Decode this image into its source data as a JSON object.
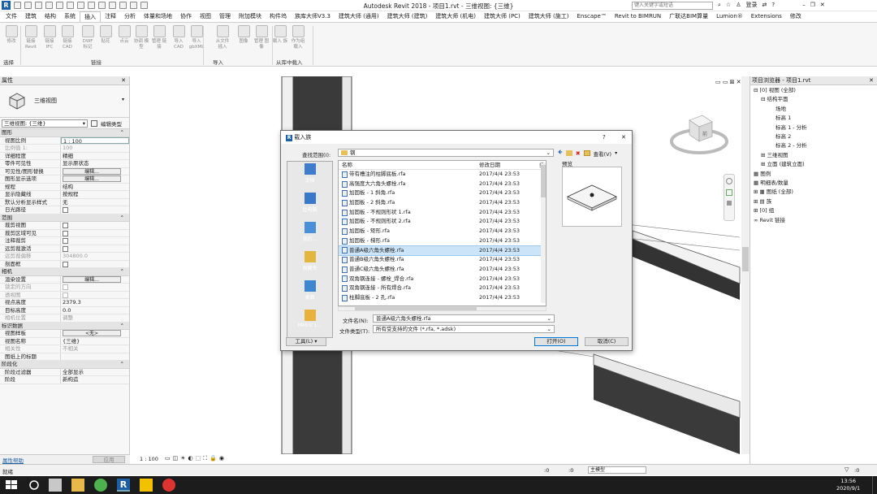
{
  "app": {
    "title": "Autodesk Revit 2018 -   项目1.rvt - 三维视图: {三维}",
    "search_placeholder": "键入关键字或短语",
    "login": "登录"
  },
  "menu": [
    "文件",
    "建筑",
    "结构",
    "系统",
    "插入",
    "注释",
    "分析",
    "体量和场地",
    "协作",
    "视图",
    "管理",
    "附加模块",
    "构件坞",
    "族库大师V3.3",
    "建筑大师 (通用)",
    "建筑大师 (建筑)",
    "建筑大师 (机电)",
    "建筑大师 (PC)",
    "建筑大师 (施工)",
    "Enscape™",
    "Revit to BIMRUN",
    "广联达BIM算量",
    "Lumion®",
    "Extensions",
    "修改"
  ],
  "active_menu_index": 4,
  "ribbon": {
    "buttons": [
      "修改",
      "链接 Revit",
      "链接 IFC",
      "链接 CAD",
      "DWF 标记",
      "贴花",
      "点云",
      "协调 模型",
      "管理 链接",
      "导入 CAD",
      "导入 gbXML",
      "从文件 插入",
      "图像",
      "管理 图像",
      "载入 族",
      "作为组 载入"
    ],
    "groups": [
      "选择",
      "链接",
      "导入",
      "从库中载入"
    ]
  },
  "properties": {
    "title": "属性",
    "type_name": "三维视图",
    "selector": "三维视图: {三维}",
    "edit_type": "编辑类型",
    "sections": [
      {
        "name": "图形",
        "rows": [
          [
            "视图比例",
            "1 : 100",
            ""
          ],
          [
            "比例值 1:",
            "100",
            "dim"
          ],
          [
            "详细程度",
            "精细",
            ""
          ],
          [
            "零件可见性",
            "显示原状态",
            ""
          ],
          [
            "可见性/图形替换",
            "编辑...",
            "btn"
          ],
          [
            "图形显示选项",
            "编辑...",
            "btn"
          ],
          [
            "规程",
            "结构",
            ""
          ],
          [
            "显示隐藏线",
            "按规程",
            ""
          ],
          [
            "默认分析显示样式",
            "无",
            ""
          ],
          [
            "日光路径",
            "",
            "cb"
          ]
        ]
      },
      {
        "name": "范围",
        "rows": [
          [
            "裁剪视图",
            "",
            "cb"
          ],
          [
            "裁剪区域可见",
            "",
            "cb"
          ],
          [
            "注释裁剪",
            "",
            "cb"
          ],
          [
            "远剪裁激活",
            "",
            "cb"
          ],
          [
            "远剪裁偏移",
            "304800.0",
            "dim"
          ],
          [
            "剖面框",
            "",
            "cb"
          ]
        ]
      },
      {
        "name": "相机",
        "rows": [
          [
            "渲染设置",
            "编辑...",
            "btn"
          ],
          [
            "锁定的方向",
            "",
            "dimcb"
          ],
          [
            "透视图",
            "",
            "dimcb"
          ],
          [
            "视点高度",
            "2379.3",
            ""
          ],
          [
            "目标高度",
            "0.0",
            ""
          ],
          [
            "相机位置",
            "调整",
            "dim"
          ]
        ]
      },
      {
        "name": "标识数据",
        "rows": [
          [
            "视图样板",
            "<无>",
            "btn"
          ],
          [
            "视图名称",
            "{三维}",
            ""
          ],
          [
            "相关性",
            "不相关",
            "dim"
          ],
          [
            "图纸上的标题",
            "",
            ""
          ]
        ]
      },
      {
        "name": "阶段化",
        "rows": [
          [
            "阶段过滤器",
            "全部显示",
            ""
          ],
          [
            "阶段",
            "新构造",
            ""
          ]
        ]
      }
    ],
    "help": "属性帮助",
    "apply": "应用"
  },
  "browser": {
    "title": "项目浏览器 - 项目1.rvt",
    "items": [
      {
        "text": "⊟ [0] 视图 (全部)",
        "indent": 0
      },
      {
        "text": "⊟ 结构平面",
        "indent": 1
      },
      {
        "text": "场地",
        "indent": 3
      },
      {
        "text": "标高 1",
        "indent": 3
      },
      {
        "text": "标高 1 - 分析",
        "indent": 3
      },
      {
        "text": "标高 2",
        "indent": 3
      },
      {
        "text": "标高 2 - 分析",
        "indent": 3
      },
      {
        "text": "⊞ 三维视图",
        "indent": 1
      },
      {
        "text": "⊞ 立面 (建筑立面)",
        "indent": 1
      },
      {
        "text": "▦ 图例",
        "indent": 0
      },
      {
        "text": "▦ 明细表/数量",
        "indent": 0
      },
      {
        "text": "⊞ ▦ 图纸 (全部)",
        "indent": 0
      },
      {
        "text": "⊞ ▤ 族",
        "indent": 0
      },
      {
        "text": "⊞ [0] 组",
        "indent": 0
      },
      {
        "text": "∞ Revit 链接",
        "indent": 0
      }
    ]
  },
  "dialog": {
    "title": "载入族",
    "help": "?",
    "lookin_label": "查找范围(I):",
    "lookin_value": "钢",
    "view_menu": "查看(V)",
    "preview_label": "预览",
    "columns": [
      "名称",
      "修改日期",
      "类"
    ],
    "files": [
      {
        "name": "带有槽注的柱脚底板.rfa",
        "date": "2017/4/4 23:53"
      },
      {
        "name": "高强度大六角头螺栓.rfa",
        "date": "2017/4/4 23:53"
      },
      {
        "name": "加固板 - 1 斜角.rfa",
        "date": "2017/4/4 23:53"
      },
      {
        "name": "加固板 - 2 斜角.rfa",
        "date": "2017/4/4 23:53"
      },
      {
        "name": "加固板 - 不规则形状 1.rfa",
        "date": "2017/4/4 23:53"
      },
      {
        "name": "加固板 - 不规则形状 2.rfa",
        "date": "2017/4/4 23:53"
      },
      {
        "name": "加固板 - 矩形.rfa",
        "date": "2017/4/4 23:53"
      },
      {
        "name": "加固板 - 梯形.rfa",
        "date": "2017/4/4 23:53"
      },
      {
        "name": "普通A级六角头螺栓.rfa",
        "date": "2017/4/4 23:53"
      },
      {
        "name": "普通B级六角头螺栓.rfa",
        "date": "2017/4/4 23:53"
      },
      {
        "name": "普通C级六角头螺栓.rfa",
        "date": "2017/4/4 23:53"
      },
      {
        "name": "双角钢连接 - 螺栓_焊合.rfa",
        "date": "2017/4/4 23:53"
      },
      {
        "name": "双角钢连接 - 所有焊合.rfa",
        "date": "2017/4/4 23:53"
      },
      {
        "name": "柱脚底板 - 2 孔.rfa",
        "date": "2017/4/4 23:53"
      }
    ],
    "selected_index": 8,
    "places": [
      "文档",
      "此电脑",
      "我的...",
      "收藏夹",
      "桌面",
      "Metric L..."
    ],
    "filename_label": "文件名(N):",
    "filename_value": "普通A级六角头螺栓.rfa",
    "filetype_label": "文件类型(T):",
    "filetype_value": "所有受支持的文件 (*.rfa, *.adsk)",
    "tools": "工具(L)",
    "open": "打开(O)",
    "cancel": "取消(C)"
  },
  "status": {
    "ready": "就绪",
    "scale": "1 : 100",
    "zero1": ":0",
    "zero2": ":0",
    "model": "主模型",
    "zero3": ":0"
  },
  "clock": {
    "time": "13:56",
    "date": "2020/9/1"
  },
  "colors": {
    "revit_blue": "#1d5fa6",
    "selection": "#cce4f7"
  }
}
